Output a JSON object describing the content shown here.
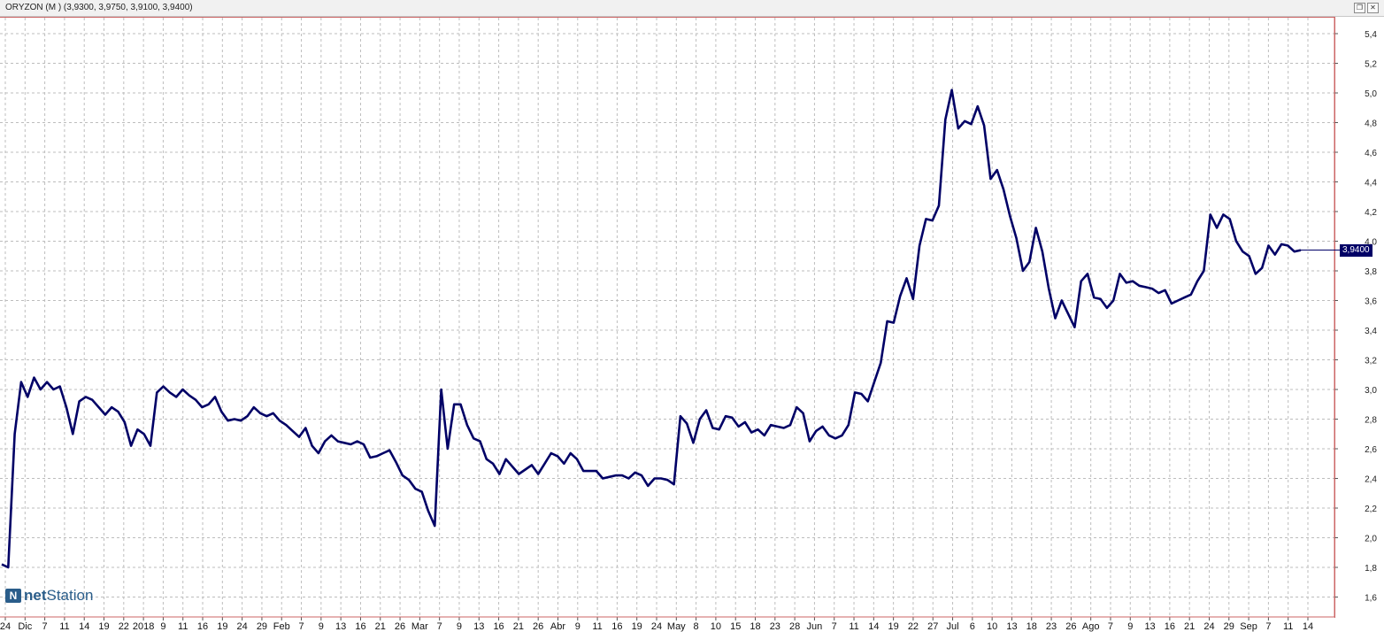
{
  "window": {
    "title": "ORYZON (M ) (3,9300, 3,9750, 3,9100, 3,9400)",
    "restore_glyph": "❐",
    "close_glyph": "✕"
  },
  "logo": {
    "mark": "N",
    "part1": "net",
    "part2": "Station"
  },
  "last_value_label": "3,9400",
  "colors": {
    "line": "#000066",
    "grid": "#bdbdbd",
    "frame": "#cc6666",
    "badge": "#000066"
  },
  "chart_data": {
    "type": "line",
    "title": "ORYZON (M ) (3,9300, 3,9750, 3,9100, 3,9400)",
    "xlabel": "",
    "ylabel": "",
    "ylim": [
      1.5,
      5.5
    ],
    "yticks": [
      "1,6",
      "1,8",
      "2,0",
      "2,2",
      "2,4",
      "2,6",
      "2,8",
      "3,0",
      "3,2",
      "3,4",
      "3,6",
      "3,8",
      "4,0",
      "4,2",
      "4,4",
      "4,6",
      "4,8",
      "5,0",
      "5,2",
      "5,4"
    ],
    "x_tick_labels": [
      "24",
      "Dic",
      "7",
      "11",
      "14",
      "19",
      "22",
      "2018",
      "9",
      "11",
      "16",
      "19",
      "24",
      "29",
      "Feb",
      "7",
      "9",
      "13",
      "16",
      "21",
      "26",
      "Mar",
      "7",
      "9",
      "13",
      "16",
      "21",
      "26",
      "Abr",
      "9",
      "11",
      "16",
      "19",
      "24",
      "May",
      "8",
      "10",
      "15",
      "18",
      "23",
      "28",
      "Jun",
      "7",
      "11",
      "14",
      "19",
      "22",
      "27",
      "Jul",
      "6",
      "10",
      "13",
      "18",
      "23",
      "26",
      "Ago",
      "7",
      "9",
      "13",
      "16",
      "21",
      "24",
      "29",
      "Sep",
      "7",
      "11",
      "14"
    ],
    "grid": true,
    "legend": "none",
    "last_value": 3.94,
    "series": [
      {
        "values": [
          1.82,
          1.8,
          2.7,
          3.05,
          2.95,
          3.08,
          3.0,
          3.05,
          3.0,
          3.02,
          2.88,
          2.7,
          2.92,
          2.95,
          2.93,
          2.88,
          2.83,
          2.88,
          2.85,
          2.78,
          2.62,
          2.73,
          2.7,
          2.62,
          2.98,
          3.02,
          2.98,
          2.95,
          3.0,
          2.96,
          2.93,
          2.88,
          2.9,
          2.95,
          2.85,
          2.79,
          2.8,
          2.79,
          2.82,
          2.88,
          2.84,
          2.82,
          2.84,
          2.79,
          2.76,
          2.72,
          2.68,
          2.74,
          2.62,
          2.57,
          2.65,
          2.69,
          2.65,
          2.64,
          2.63,
          2.65,
          2.63,
          2.54,
          2.55,
          2.57,
          2.59,
          2.51,
          2.42,
          2.39,
          2.33,
          2.31,
          2.18,
          2.08,
          3.0,
          2.6,
          2.9,
          2.9,
          2.76,
          2.67,
          2.65,
          2.53,
          2.5,
          2.43,
          2.53,
          2.48,
          2.43,
          2.46,
          2.49,
          2.43,
          2.5,
          2.57,
          2.55,
          2.5,
          2.57,
          2.53,
          2.45,
          2.45,
          2.45,
          2.4,
          2.41,
          2.42,
          2.42,
          2.4,
          2.44,
          2.42,
          2.35,
          2.4,
          2.4,
          2.39,
          2.36,
          2.82,
          2.77,
          2.64,
          2.8,
          2.86,
          2.74,
          2.73,
          2.82,
          2.81,
          2.75,
          2.78,
          2.71,
          2.73,
          2.69,
          2.76,
          2.75,
          2.74,
          2.76,
          2.88,
          2.84,
          2.65,
          2.72,
          2.75,
          2.69,
          2.67,
          2.69,
          2.76,
          2.98,
          2.97,
          2.92,
          3.05,
          3.18,
          3.46,
          3.45,
          3.63,
          3.75,
          3.61,
          3.97,
          4.15,
          4.14,
          4.24,
          4.82,
          5.02,
          4.76,
          4.81,
          4.79,
          4.91,
          4.78,
          4.42,
          4.48,
          4.35,
          4.17,
          4.02,
          3.8,
          3.86,
          4.09,
          3.93,
          3.68,
          3.48,
          3.6,
          3.51,
          3.42,
          3.73,
          3.78,
          3.62,
          3.61,
          3.55,
          3.6,
          3.78,
          3.72,
          3.73,
          3.7,
          3.69,
          3.68,
          3.65,
          3.67,
          3.58,
          3.6,
          3.62,
          3.64,
          3.73,
          3.8,
          4.18,
          4.09,
          4.18,
          4.15,
          4.0,
          3.93,
          3.9,
          3.78,
          3.82,
          3.97,
          3.91,
          3.98,
          3.97,
          3.93,
          3.94
        ]
      }
    ]
  }
}
